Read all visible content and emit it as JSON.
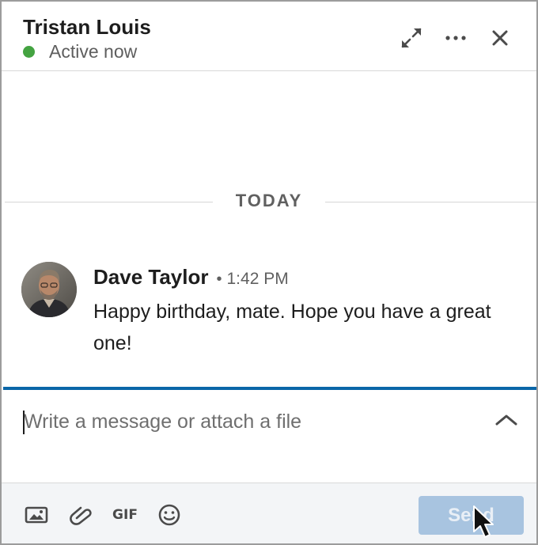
{
  "header": {
    "contact_name": "Tristan Louis",
    "presence_status": "Active now",
    "presence_color": "#44a341",
    "actions": [
      {
        "icon": "expand-arrows-icon"
      },
      {
        "icon": "more-options-icon"
      },
      {
        "icon": "close-icon"
      }
    ]
  },
  "conversation": {
    "day_label": "TODAY",
    "messages": [
      {
        "sender": "Dave Taylor",
        "separator": "•",
        "time": "1:42 PM",
        "text": "Happy birthday, mate. Hope you have a great one!",
        "avatar": "profile-photo"
      }
    ]
  },
  "composer": {
    "placeholder": "Write a message or attach a file",
    "value": "",
    "accent_color": "#0a66a8",
    "expand_icon": "chevron-up-icon"
  },
  "toolbar": {
    "items": [
      {
        "icon": "image-icon"
      },
      {
        "icon": "paperclip-icon"
      },
      {
        "icon": "gif-icon",
        "label": "GIF"
      },
      {
        "icon": "emoji-icon"
      }
    ],
    "send_label": "Send",
    "send_state": "disabled"
  }
}
